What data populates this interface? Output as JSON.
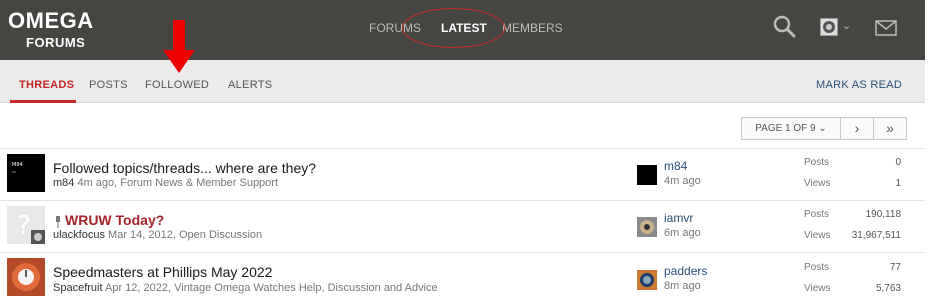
{
  "header": {
    "logo_main": "OMEGA",
    "logo_sub": "FORUMS",
    "nav": [
      {
        "label": "FORUMS"
      },
      {
        "label": "LATEST"
      },
      {
        "label": "MEMBERS"
      }
    ]
  },
  "subnav": {
    "tabs": [
      {
        "label": "THREADS"
      },
      {
        "label": "POSTS"
      },
      {
        "label": "FOLLOWED"
      },
      {
        "label": "ALERTS"
      }
    ],
    "mark_read": "MARK AS READ"
  },
  "pager": {
    "label": "PAGE 1 OF 9",
    "dropdown": "⌄",
    "next": "›",
    "last": "»"
  },
  "threads": [
    {
      "title": "Followed topics/threads... where are they?",
      "author": "m84",
      "time": "4m ago",
      "forum": "Forum News & Member Support",
      "last_user": "m84",
      "last_time": "4m ago",
      "posts_label": "Posts",
      "posts": "0",
      "views_label": "Views",
      "views": "1"
    },
    {
      "title": "WRUW Today?",
      "author": "ulackfocus",
      "time": "Mar 14, 2012",
      "forum": "Open Discussion",
      "last_user": "iamvr",
      "last_time": "6m ago",
      "posts_label": "Posts",
      "posts": "190,118",
      "views_label": "Views",
      "views": "31,967,511"
    },
    {
      "title": "Speedmasters at Phillips May 2022",
      "author": "Spacefruit",
      "time": "Apr 12, 2022",
      "forum": "Vintage Omega Watches Help, Discussion and Advice",
      "last_user": "padders",
      "last_time": "8m ago",
      "posts_label": "Posts",
      "posts": "77",
      "views_label": "Views",
      "views": "5,763"
    }
  ],
  "colors": {
    "header_bg": "#474542",
    "accent_red": "#c62828",
    "link_blue": "#2a5078"
  }
}
